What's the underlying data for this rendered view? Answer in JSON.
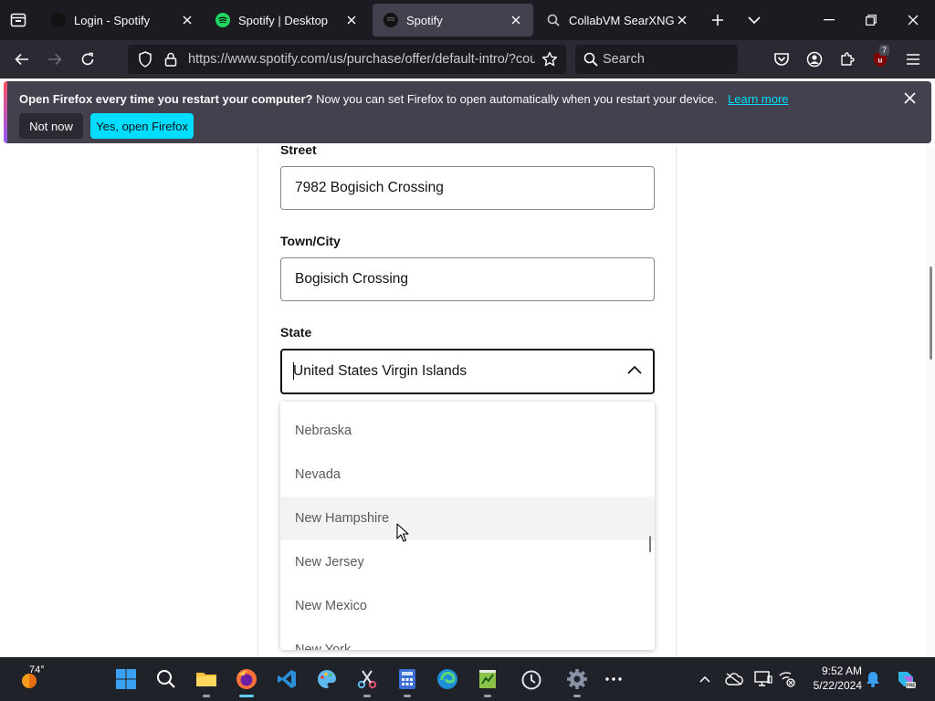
{
  "browser": {
    "tabs": [
      {
        "title": "Login - Spotify",
        "active": false
      },
      {
        "title": "Spotify | Desktop",
        "active": false
      },
      {
        "title": "Spotify",
        "active": true
      },
      {
        "title": "CollabVM SearXNG",
        "active": false
      }
    ],
    "url": "https://www.spotify.com/us/purchase/offer/default-intro/?country=US",
    "search_placeholder": "Search",
    "extension_badge": "7"
  },
  "notification": {
    "title": "Open Firefox every time you restart your computer?",
    "message": "Now you can set Firefox to open automatically when you restart your device.",
    "learn_more": "Learn more",
    "not_now": "Not now",
    "yes_open": "Yes, open Firefox"
  },
  "form": {
    "street_label": "Street",
    "street_value": "7982 Bogisich Crossing",
    "city_label": "Town/City",
    "city_value": "Bogisich Crossing",
    "state_label": "State",
    "state_value": "United States Virgin Islands",
    "state_options": [
      "Nebraska",
      "Nevada",
      "New Hampshire",
      "New Jersey",
      "New Mexico",
      "New York"
    ],
    "hover_option": "New Hampshire"
  },
  "taskbar": {
    "weather_temp": "74°",
    "time": "9:52 AM",
    "date": "5/22/2024"
  },
  "colors": {
    "accent_cyan": "#00ddff",
    "tab_bg": "#1c1b22",
    "active_tab_bg": "#42414d",
    "toolbar_bg": "#2b2a33",
    "spotify_green": "#1ed760"
  }
}
